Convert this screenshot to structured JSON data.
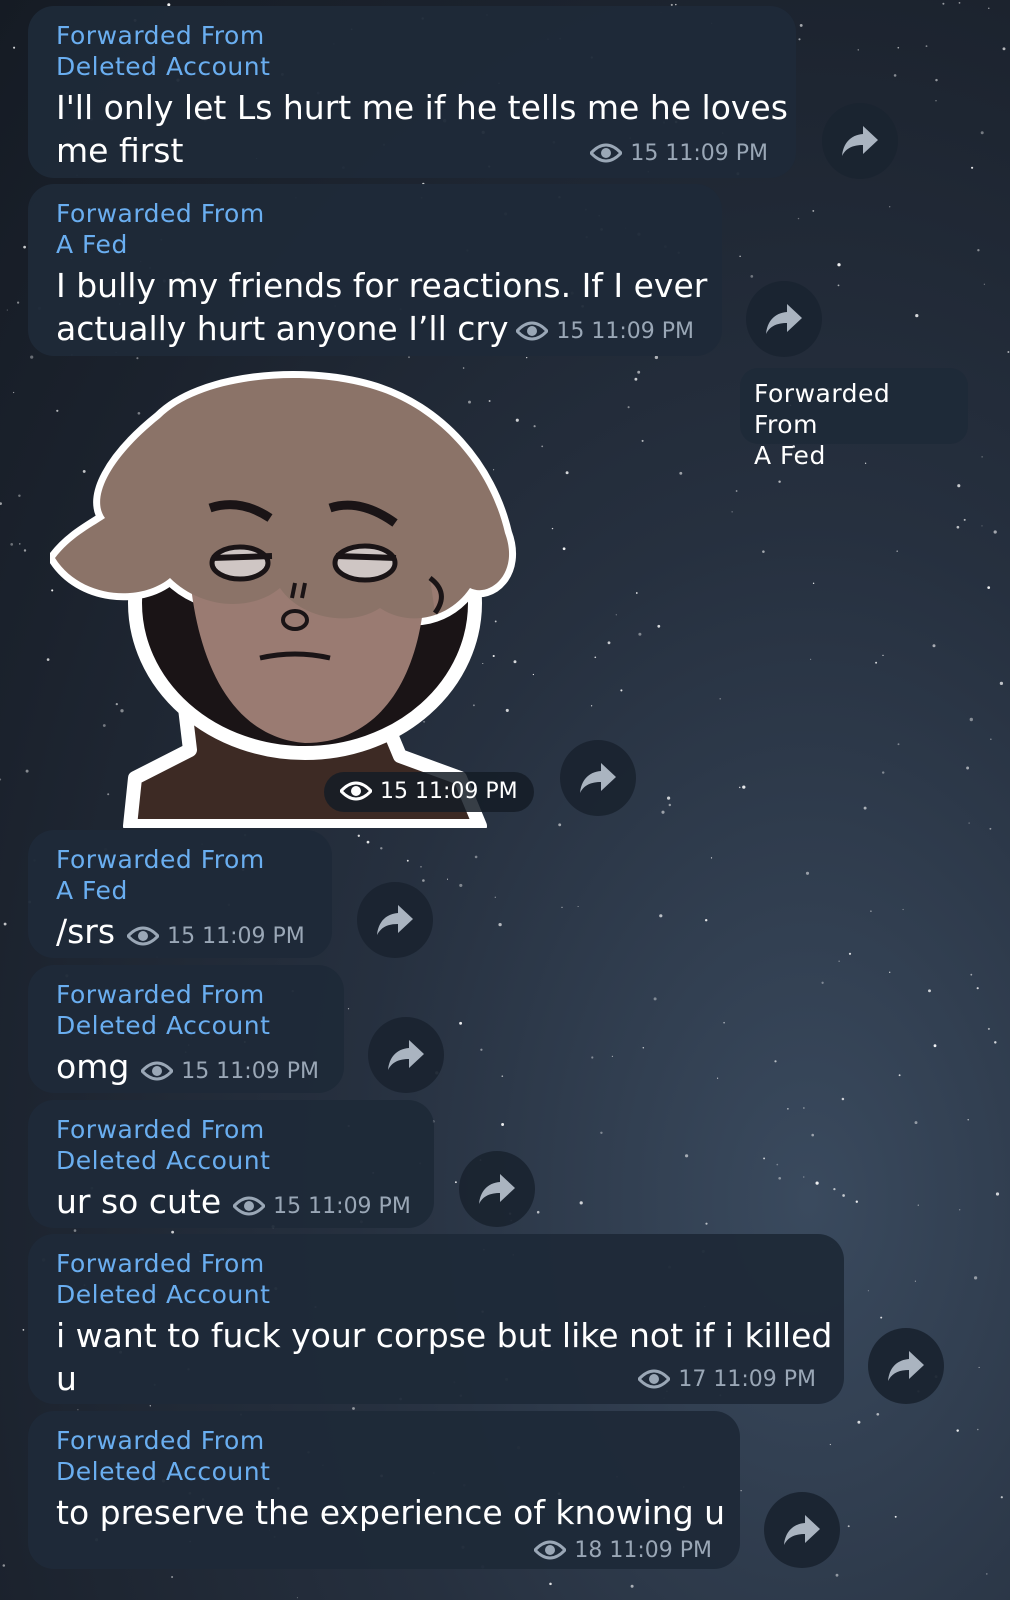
{
  "messages": [
    {
      "forwarded_label": "Forwarded From",
      "sender": "Deleted Account",
      "text_lines": [
        "I'll only let Ls hurt me if he tells me he loves",
        "me first"
      ],
      "views": "15",
      "time": "11:09 PM"
    },
    {
      "forwarded_label": "Forwarded From",
      "sender": "A Fed",
      "text_lines": [
        "I bully my friends for reactions. If I ever",
        "actually hurt anyone I’ll cry"
      ],
      "views": "15",
      "time": "11:09 PM"
    },
    {
      "type": "sticker",
      "forwarded_label": "Forwarded From",
      "sender": "A Fed",
      "views": "15",
      "time": "11:09 PM"
    },
    {
      "forwarded_label": "Forwarded From",
      "sender": "A Fed",
      "text": "/srs",
      "views": "15",
      "time": "11:09 PM"
    },
    {
      "forwarded_label": "Forwarded From",
      "sender": "Deleted Account",
      "text": "omg",
      "views": "15",
      "time": "11:09 PM"
    },
    {
      "forwarded_label": "Forwarded From",
      "sender": "Deleted Account",
      "text": "ur so cute",
      "views": "15",
      "time": "11:09 PM"
    },
    {
      "forwarded_label": "Forwarded From",
      "sender": "Deleted Account",
      "text_lines": [
        "i want to fuck your corpse but like not if i killed",
        "u"
      ],
      "views": "17",
      "time": "11:09 PM"
    },
    {
      "forwarded_label": "Forwarded From",
      "sender": "Deleted Account",
      "text": "to preserve the experience of knowing u",
      "views": "18",
      "time": "11:09 PM"
    }
  ],
  "icons": {
    "views": "eye-icon",
    "share": "share-arrow-icon"
  },
  "colors": {
    "bubble": "#1e2a38",
    "forward_link": "#6aaef0",
    "meta": "#9aa7b6",
    "text": "#ffffff"
  }
}
